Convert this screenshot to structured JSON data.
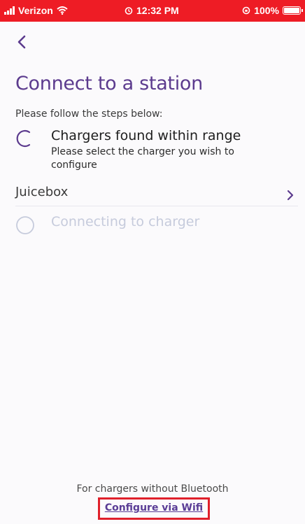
{
  "status_bar": {
    "carrier": "Verizon",
    "time": "12:32 PM",
    "battery": "100%",
    "icons": [
      "signal-icon",
      "wifi-icon",
      "alarm-icon",
      "battery-icon"
    ]
  },
  "header": {
    "back_icon": "chevron-left-icon"
  },
  "page": {
    "title": "Connect to a station",
    "instructions": "Please follow the steps below:"
  },
  "steps": [
    {
      "title": "Chargers found within range",
      "description": "Please select the charger you wish to configure",
      "status": "in-progress",
      "icon": "spinner-icon"
    },
    {
      "title": "Connecting to charger",
      "status": "pending",
      "icon": "circle-icon"
    }
  ],
  "chargers": [
    {
      "name": "Juicebox",
      "icon": "chevron-right-icon"
    }
  ],
  "footer": {
    "note": "For chargers without Bluetooth",
    "link_label": "Configure via Wifi"
  },
  "colors": {
    "status_bar": "#ee1c25",
    "accent_purple": "#5c3b8e",
    "disabled_text": "#c6cbdc",
    "highlight_box": "#e0202b",
    "background": "#fbfafc"
  }
}
